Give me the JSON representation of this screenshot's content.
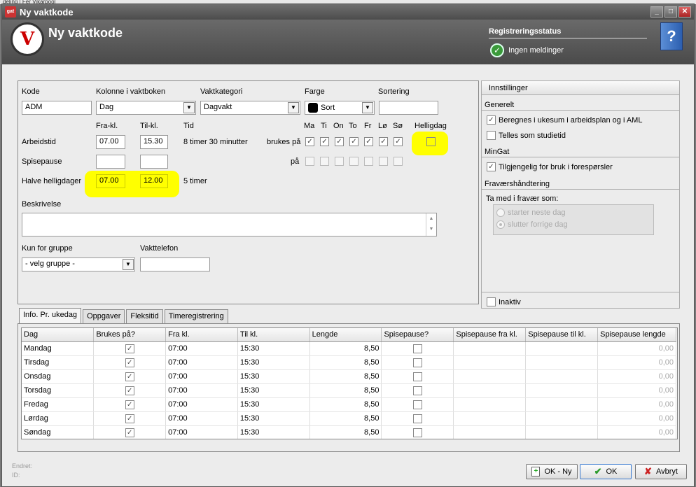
{
  "window": {
    "title": "Ny vaktkode"
  },
  "behind_text": "deling  |  Fer Vikarpool",
  "header": {
    "title": "Ny vaktkode",
    "reg_status_title": "Registreringsstatus",
    "reg_status_text": "Ingen meldinger"
  },
  "form": {
    "kode_label": "Kode",
    "kode_value": "ADM",
    "kolonne_label": "Kolonne i vaktboken",
    "kolonne_value": "Dag",
    "kategori_label": "Vaktkategori",
    "kategori_value": "Dagvakt",
    "farge_label": "Farge",
    "farge_value": "Sort",
    "sortering_label": "Sortering",
    "sortering_value": "",
    "fra_label": "Fra-kl.",
    "til_label": "Til-kl.",
    "tid_label": "Tid",
    "arbeidstid_label": "Arbeidstid",
    "arbeidstid_fra": "07.00",
    "arbeidstid_til": "15.30",
    "arbeidstid_tid": "8 timer 30 minutter",
    "spisepause_label": "Spisepause",
    "spisepause_fra": "",
    "spisepause_til": "",
    "halve_label": "Halve helligdager",
    "halve_fra": "07.00",
    "halve_til": "12.00",
    "halve_tid": "5 timer",
    "days": [
      "Ma",
      "Ti",
      "On",
      "To",
      "Fr",
      "Lø",
      "Sø"
    ],
    "helligdag_label": "Helligdag",
    "brukes_pa_label": "brukes på",
    "pa_label": "på",
    "beskrivelse_label": "Beskrivelse",
    "beskrivelse_value": "",
    "gruppe_label": "Kun for gruppe",
    "gruppe_value": "- velg gruppe -",
    "vakttelefon_label": "Vakttelefon",
    "vakttelefon_value": ""
  },
  "settings": {
    "title": "Innstillinger",
    "generelt": "Generelt",
    "beregnes": "Beregnes i ukesum i arbeidsplan og i AML",
    "telles": "Telles som studietid",
    "mingat": "MinGat",
    "tilgjengelig": "Tilgjengelig for bruk i forespørsler",
    "fravaer": "Fraværshåndtering",
    "ta_med": "Ta med i fravær som:",
    "radio1": "starter neste dag",
    "radio2": "slutter forrige dag",
    "inaktiv": "Inaktiv"
  },
  "tabs": [
    "Info. Pr. ukedag",
    "Oppgaver",
    "Fleksitid",
    "Timeregistrering"
  ],
  "grid": {
    "columns": [
      "Dag",
      "Brukes på?",
      "Fra kl.",
      "Til kl.",
      "Lengde",
      "Spisepause?",
      "Spisepause fra kl.",
      "Spisepause til kl.",
      "Spisepause lengde"
    ],
    "rows": [
      {
        "dag": "Mandag",
        "fra": "07:00",
        "til": "15:30",
        "lengde": "8,50",
        "sp_lengde": "0,00"
      },
      {
        "dag": "Tirsdag",
        "fra": "07:00",
        "til": "15:30",
        "lengde": "8,50",
        "sp_lengde": "0,00"
      },
      {
        "dag": "Onsdag",
        "fra": "07:00",
        "til": "15:30",
        "lengde": "8,50",
        "sp_lengde": "0,00"
      },
      {
        "dag": "Torsdag",
        "fra": "07:00",
        "til": "15:30",
        "lengde": "8,50",
        "sp_lengde": "0,00"
      },
      {
        "dag": "Fredag",
        "fra": "07:00",
        "til": "15:30",
        "lengde": "8,50",
        "sp_lengde": "0,00"
      },
      {
        "dag": "Lørdag",
        "fra": "07:00",
        "til": "15:30",
        "lengde": "8,50",
        "sp_lengde": "0,00"
      },
      {
        "dag": "Søndag",
        "fra": "07:00",
        "til": "15:30",
        "lengde": "8,50",
        "sp_lengde": "0,00"
      }
    ]
  },
  "footer": {
    "endret_label": "Endret:",
    "id_label": "ID:",
    "ok_ny": "OK - Ny",
    "ok": "OK",
    "avbryt": "Avbryt"
  }
}
